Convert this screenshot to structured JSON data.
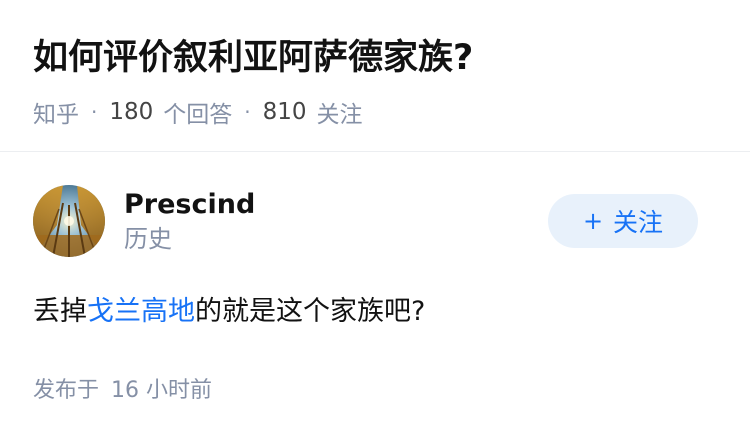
{
  "question": {
    "title": "如何评价叙利亚阿萨德家族?",
    "source": "知乎",
    "answer_count": "180",
    "answer_label": "个回答",
    "follower_count": "810",
    "follower_label": "关注"
  },
  "answer": {
    "author_name": "Prescind",
    "author_bio": "历史",
    "follow_label": "关注",
    "text_before": "丢掉",
    "link_text": "戈兰高地",
    "text_after": "的就是这个家族吧?",
    "publish_label": "发布于",
    "publish_time": "16 小时前"
  },
  "colors": {
    "accent": "#1772f6",
    "follow_bg": "#e8f1fb",
    "meta_text": "#8590a6"
  },
  "icons": {
    "follow": "plus-icon",
    "avatar": "autumn-forest-avatar"
  }
}
